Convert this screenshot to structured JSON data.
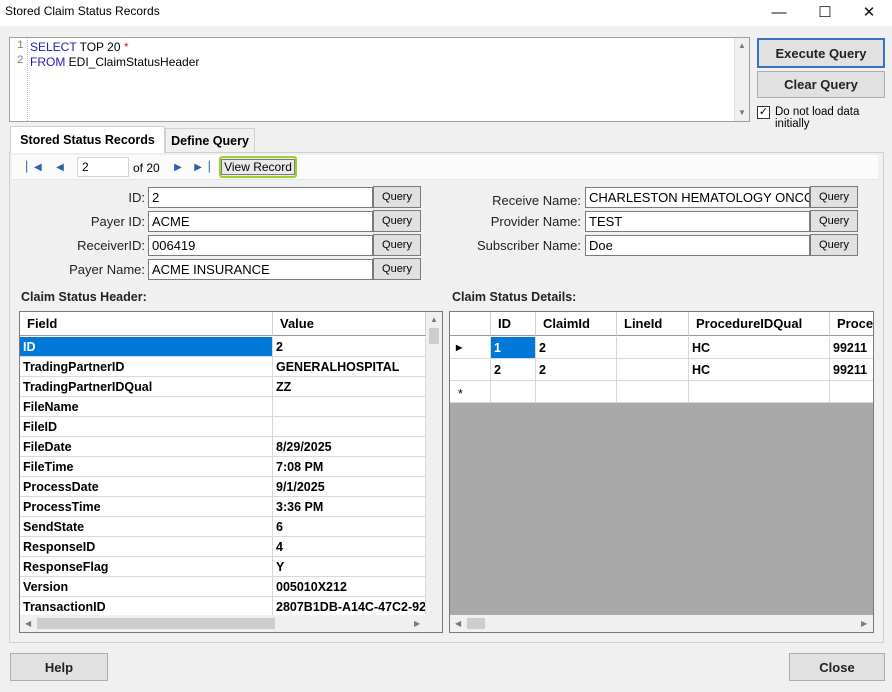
{
  "window": {
    "title": "Stored Claim Status Records",
    "minimize": "—",
    "maximize": "☐",
    "close": "✕"
  },
  "query": {
    "line1_num": "1",
    "line2_num": "2",
    "line1_kw": "SELECT",
    "line1_rest": " TOP 20 ",
    "line1_star": "*",
    "line2_kw": "FROM",
    "line2_rest": " EDI_ClaimStatusHeader"
  },
  "buttons": {
    "execute": "Execute Query",
    "clear": "Clear Query",
    "help": "Help",
    "close": "Close"
  },
  "checkbox": {
    "label": "Do not load data initially",
    "checked": true,
    "mark": "✓"
  },
  "tabs": [
    {
      "label": "Stored Status Records"
    },
    {
      "label": "Define Query"
    }
  ],
  "navigator": {
    "position": "2",
    "of_label": "of 20",
    "view_record": "View Record"
  },
  "fields": {
    "id": {
      "label": "ID:",
      "value": "2"
    },
    "payer_id": {
      "label": "Payer ID:",
      "value": "ACME"
    },
    "receiver_id": {
      "label": "ReceiverID:",
      "value": "006419"
    },
    "payer_name": {
      "label": "Payer Name:",
      "value": "ACME INSURANCE"
    },
    "receive_name": {
      "label": "Receive Name:",
      "value": "CHARLESTON HEMATOLOGY ONCOLOGY"
    },
    "provider_name": {
      "label": "Provider Name:",
      "value": "TEST"
    },
    "subscriber_name": {
      "label": "Subscriber Name:",
      "value": "Doe"
    },
    "query_label": "Query"
  },
  "header_grid": {
    "title": "Claim Status Header:",
    "columns": [
      "Field",
      "Value"
    ],
    "rows": [
      [
        "ID",
        "2"
      ],
      [
        "TradingPartnerID",
        "GENERALHOSPITAL"
      ],
      [
        "TradingPartnerIDQual",
        "ZZ"
      ],
      [
        "FileName",
        ""
      ],
      [
        "FileID",
        ""
      ],
      [
        "FileDate",
        "8/29/2025"
      ],
      [
        "FileTime",
        "7:08 PM"
      ],
      [
        "ProcessDate",
        "9/1/2025"
      ],
      [
        "ProcessTime",
        "3:36 PM"
      ],
      [
        "SendState",
        "6"
      ],
      [
        "ResponseID",
        "4"
      ],
      [
        "ResponseFlag",
        "Y"
      ],
      [
        "Version",
        "005010X212"
      ],
      [
        "TransactionID",
        "2807B1DB-A14C-47C2-92"
      ]
    ]
  },
  "details_grid": {
    "title": "Claim Status Details:",
    "columns": [
      "ID",
      "ClaimId",
      "LineId",
      "ProcedureIDQual",
      "Proce"
    ],
    "rows": [
      [
        "1",
        "2",
        "",
        "HC",
        "99211"
      ],
      [
        "2",
        "2",
        "",
        "HC",
        "99211"
      ]
    ],
    "current_row_marker": "▶",
    "new_row_marker": "*"
  }
}
